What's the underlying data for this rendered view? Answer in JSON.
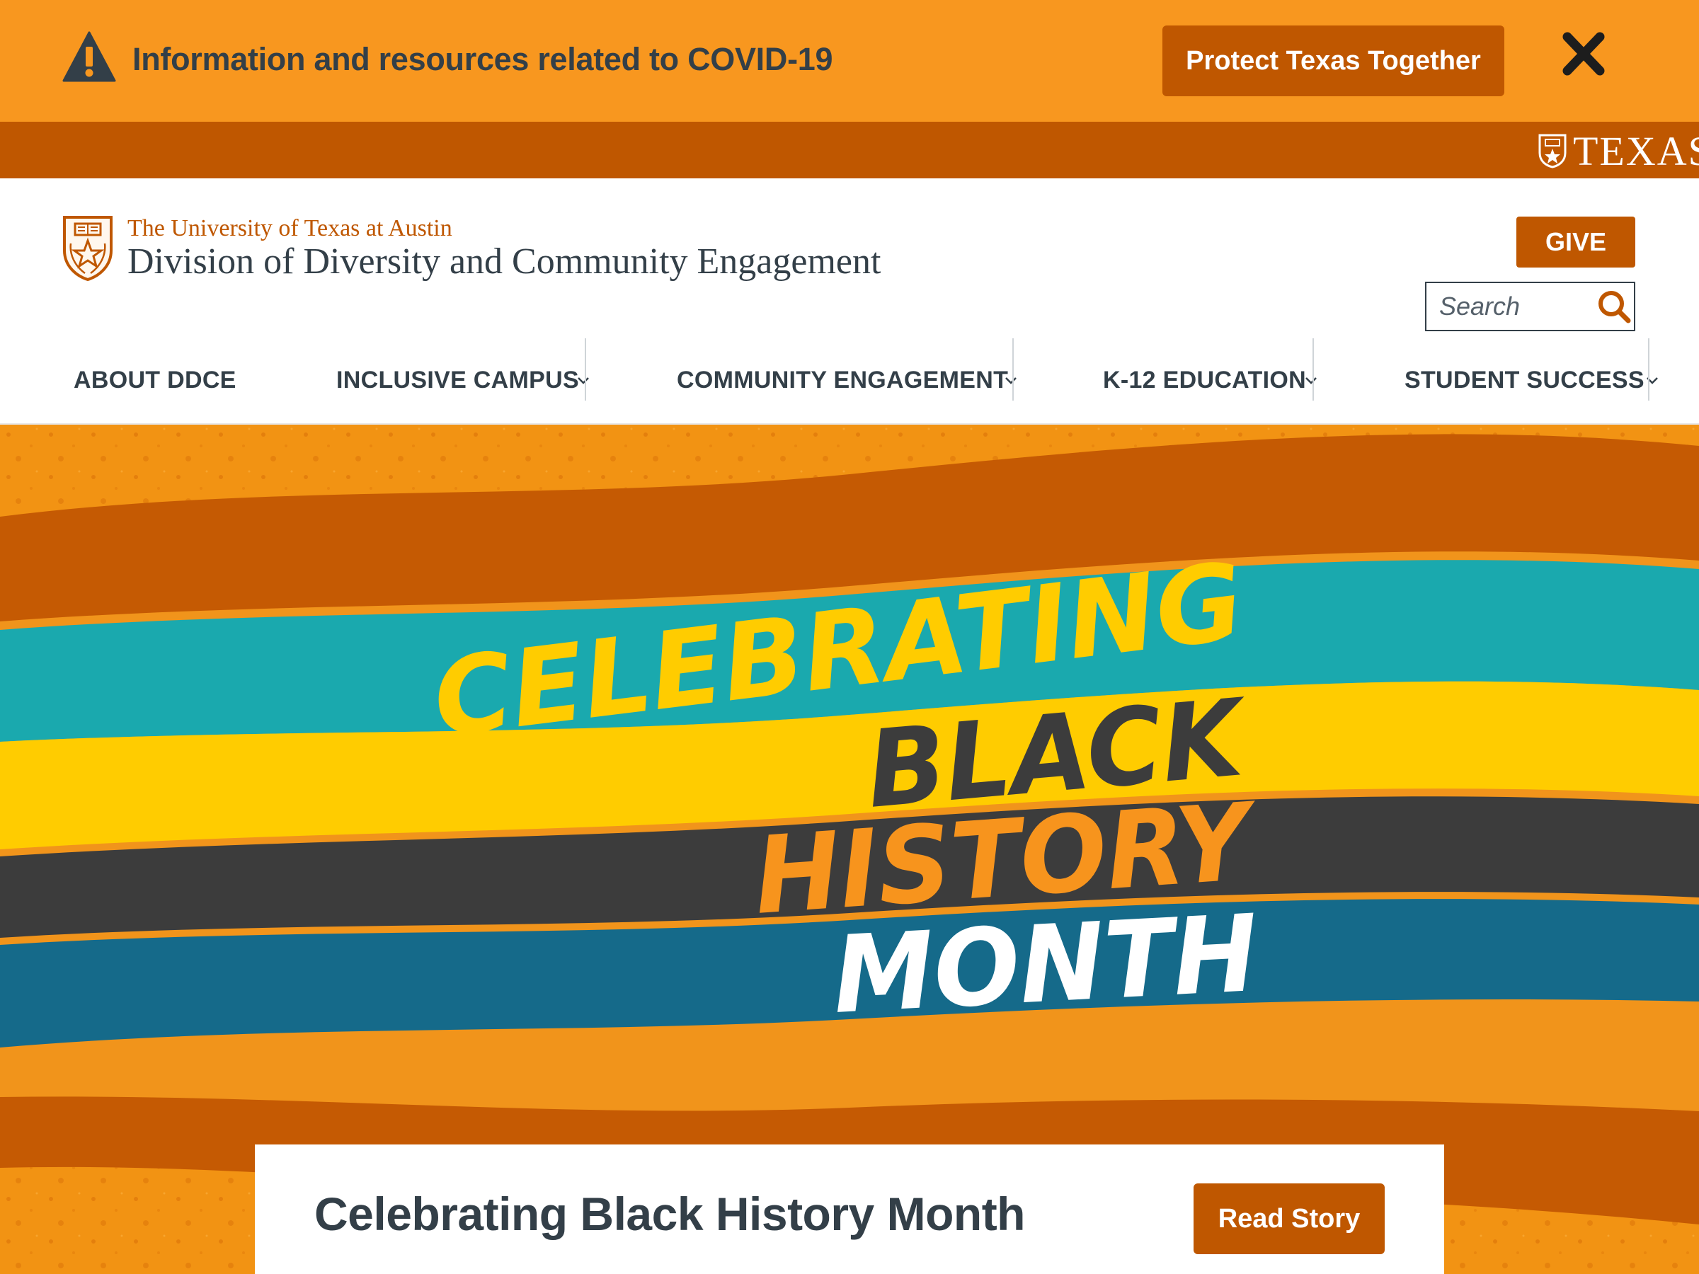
{
  "alert": {
    "icon": "warning-triangle-icon",
    "text": "Information and resources related to COVID-19",
    "button_label": "Protect Texas Together",
    "close_icon": "close-x-icon"
  },
  "texas_bar": {
    "wordmark": "TEXAS"
  },
  "header": {
    "university": "The University of Texas at Austin",
    "division": "Division of Diversity and Community Engagement",
    "give_label": "GIVE",
    "search": {
      "placeholder": "Search",
      "value": ""
    }
  },
  "nav": {
    "items": [
      {
        "label": "ABOUT DDCE",
        "has_dropdown": false
      },
      {
        "label": "INCLUSIVE CAMPUS",
        "has_dropdown": true
      },
      {
        "label": "COMMUNITY ENGAGEMENT",
        "has_dropdown": true
      },
      {
        "label": "K-12 EDUCATION",
        "has_dropdown": true
      },
      {
        "label": "STUDENT SUCCESS",
        "has_dropdown": true
      }
    ]
  },
  "hero": {
    "banner_lines": [
      "CELEBRATING",
      "BLACK",
      "HISTORY",
      "MONTH"
    ],
    "card_title": "Celebrating Black History Month",
    "card_button": "Read Story"
  },
  "colors": {
    "burnt_orange": "#bf5700",
    "alert_orange": "#f8971f",
    "charcoal": "#333f48",
    "teal": "#1aa9ae",
    "yellow": "#ffcc00",
    "dark_band": "#3c3c3c",
    "blue_band": "#156a8a"
  }
}
